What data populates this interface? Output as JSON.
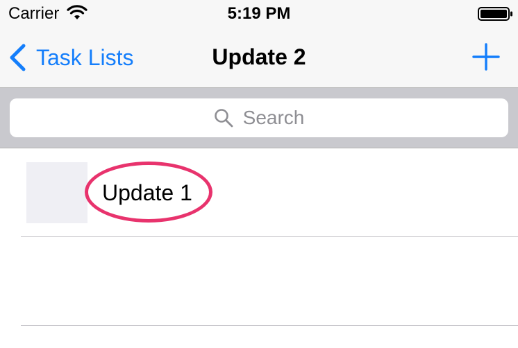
{
  "status_bar": {
    "carrier": "Carrier",
    "time": "5:19 PM",
    "wifi_icon": "wifi-icon",
    "battery_icon": "battery-icon"
  },
  "nav_bar": {
    "back_label": "Task Lists",
    "back_icon": "chevron-left-icon",
    "title": "Update 2",
    "add_icon": "plus-icon"
  },
  "search": {
    "placeholder": "Search",
    "icon": "search-icon"
  },
  "list": {
    "items": [
      {
        "label": "Update 1",
        "highlighted": true
      }
    ]
  },
  "colors": {
    "accent": "#147efb",
    "highlight": "#e8336d",
    "bar_background": "#f7f7f7",
    "search_background": "#c9c9ce",
    "thumb": "#efeff4"
  }
}
